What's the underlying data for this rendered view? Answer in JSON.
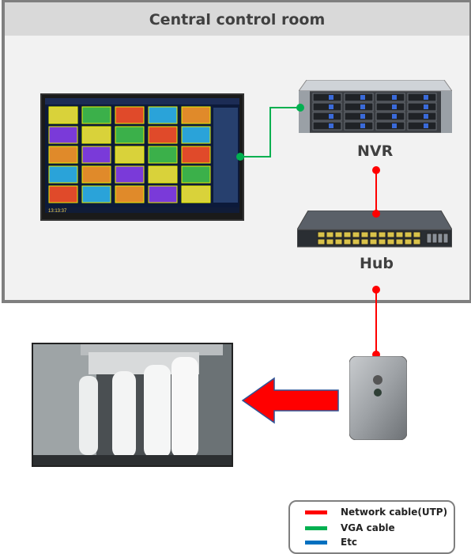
{
  "room": {
    "title": "Central control room"
  },
  "devices": {
    "nvr_label": "NVR",
    "hub_label": "Hub"
  },
  "legend": {
    "items": [
      {
        "label": "Network cable(UTP)",
        "color": "#ff0000"
      },
      {
        "label": "VGA cable",
        "color": "#00b050"
      },
      {
        "label": "Etc",
        "color": "#0070c0"
      }
    ]
  },
  "colors": {
    "network": "#ff0000",
    "vga": "#00b050",
    "arrow_fill": "#ff0000",
    "arrow_stroke": "#2f5597",
    "room_border": "#7f7f7f"
  }
}
